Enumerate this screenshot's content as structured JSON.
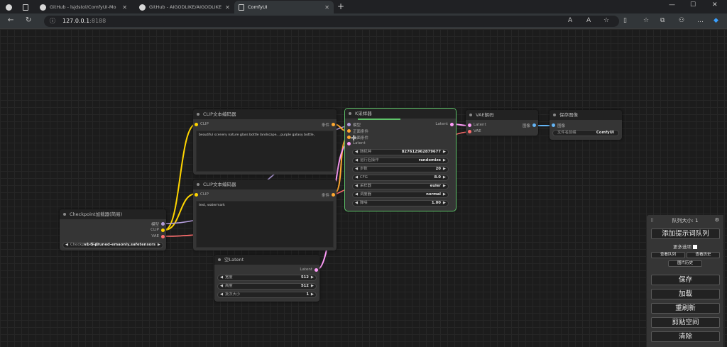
{
  "browser": {
    "tabs": [
      {
        "label": "GitHub - lsjdstol/ComfyUI-Mo"
      },
      {
        "label": "GitHub - AIGODLIKE/AIGODLIKE"
      },
      {
        "label": "ComfyUI"
      }
    ],
    "url_host": "127.0.0.1",
    "url_port": ":8188"
  },
  "nodes": {
    "clip_pos": {
      "title": "CLIP文本编码器",
      "in_clip": "CLIP",
      "out": "条件",
      "text": "beautiful scenery nature glass bottle landscape, , purple galaxy bottle,"
    },
    "clip_neg": {
      "title": "CLIP文本编码器",
      "in_clip": "CLIP",
      "out": "条件",
      "text": "text, watermark"
    },
    "checkpoint": {
      "title": "Checkpoint加载器(简易)",
      "out_model": "模型",
      "out_clip": "CLIP",
      "out_vae": "VAE",
      "ckpt_label": "Checkpoint名称",
      "ckpt_value": "v1-5-pruned-emaonly.safetensors"
    },
    "latent": {
      "title": "空Latent",
      "out": "Latent",
      "widgets": [
        {
          "label": "宽度",
          "value": "512"
        },
        {
          "label": "高度",
          "value": "512"
        },
        {
          "label": "批次大小",
          "value": "1"
        }
      ]
    },
    "ksampler": {
      "title": "K采样器",
      "inputs": [
        "模型",
        "正面条件",
        "负面条件",
        "Latent"
      ],
      "out": "Latent",
      "widgets": [
        {
          "label": "随机种",
          "value": "827612962879677"
        },
        {
          "label": "运行后操作",
          "value": "randomize"
        },
        {
          "label": "步数",
          "value": "20"
        },
        {
          "label": "CFG",
          "value": "8.0"
        },
        {
          "label": "采样器",
          "value": "euler"
        },
        {
          "label": "调度器",
          "value": "normal"
        },
        {
          "label": "降噪",
          "value": "1.00"
        }
      ]
    },
    "vae_decode": {
      "title": "VAE解码",
      "in_latent": "Latent",
      "in_vae": "VAE",
      "out": "图像"
    },
    "save_image": {
      "title": "保存图像",
      "in": "图像",
      "prefix_label": "文件名前缀",
      "prefix_value": "ComfyUI"
    }
  },
  "panel": {
    "queue_title": "队列大小: 1",
    "queue_prompt": "添加提示词队列",
    "extra_options": "更多选项",
    "view_queue": "查看队列",
    "view_history": "查看历史",
    "share": "图片历史",
    "save": "保存",
    "load": "加载",
    "refresh": "重刷新",
    "clipspace": "剪贴空间",
    "clear": "清除"
  },
  "colors": {
    "clip_wire": "#ffd500",
    "model_wire": "#b39ddb",
    "cond_wire": "#ffa931",
    "latent_wire": "#ff9cf9",
    "vae_wire": "#ff6e6e",
    "image_wire": "#64b5f6",
    "selected_outline": "#5fc46a"
  }
}
